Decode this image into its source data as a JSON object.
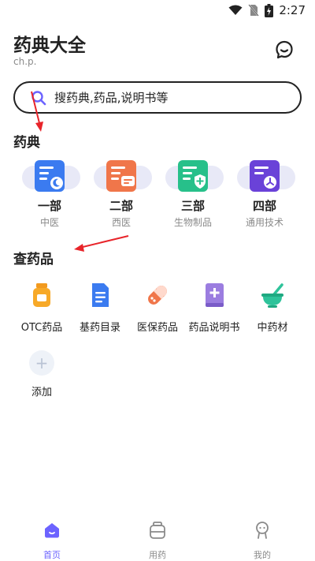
{
  "status_bar": {
    "time": "2:27"
  },
  "header": {
    "title": "药典大全",
    "subtitle": "ch.p."
  },
  "search": {
    "placeholder": "搜药典,药品,说明书等"
  },
  "pharmacopoeia": {
    "title": "药典",
    "items": [
      {
        "name": "一部",
        "sub": "中医",
        "color": "#3b7bf0",
        "icon": "moon-doc-icon"
      },
      {
        "name": "二部",
        "sub": "西医",
        "color": "#f0764a",
        "icon": "chat-doc-icon"
      },
      {
        "name": "三部",
        "sub": "生物制品",
        "color": "#27c08a",
        "icon": "shield-doc-icon"
      },
      {
        "name": "四部",
        "sub": "通用技术",
        "color": "#6a42d8",
        "icon": "clock-doc-icon"
      }
    ]
  },
  "check_drugs": {
    "title": "查药品",
    "items": [
      {
        "label": "OTC药品",
        "icon": "medicine-bottle-icon"
      },
      {
        "label": "基药目录",
        "icon": "document-icon"
      },
      {
        "label": "医保药品",
        "icon": "capsule-icon"
      },
      {
        "label": "药品说明书",
        "icon": "medical-book-icon"
      },
      {
        "label": "中药材",
        "icon": "mortar-icon"
      }
    ],
    "add_label": "添加"
  },
  "bottom_nav": {
    "items": [
      {
        "label": "首页",
        "active": true
      },
      {
        "label": "用药",
        "active": false
      },
      {
        "label": "我的",
        "active": false
      }
    ]
  },
  "colors": {
    "accent": "#6c63ff",
    "arrow": "#e8242a"
  }
}
